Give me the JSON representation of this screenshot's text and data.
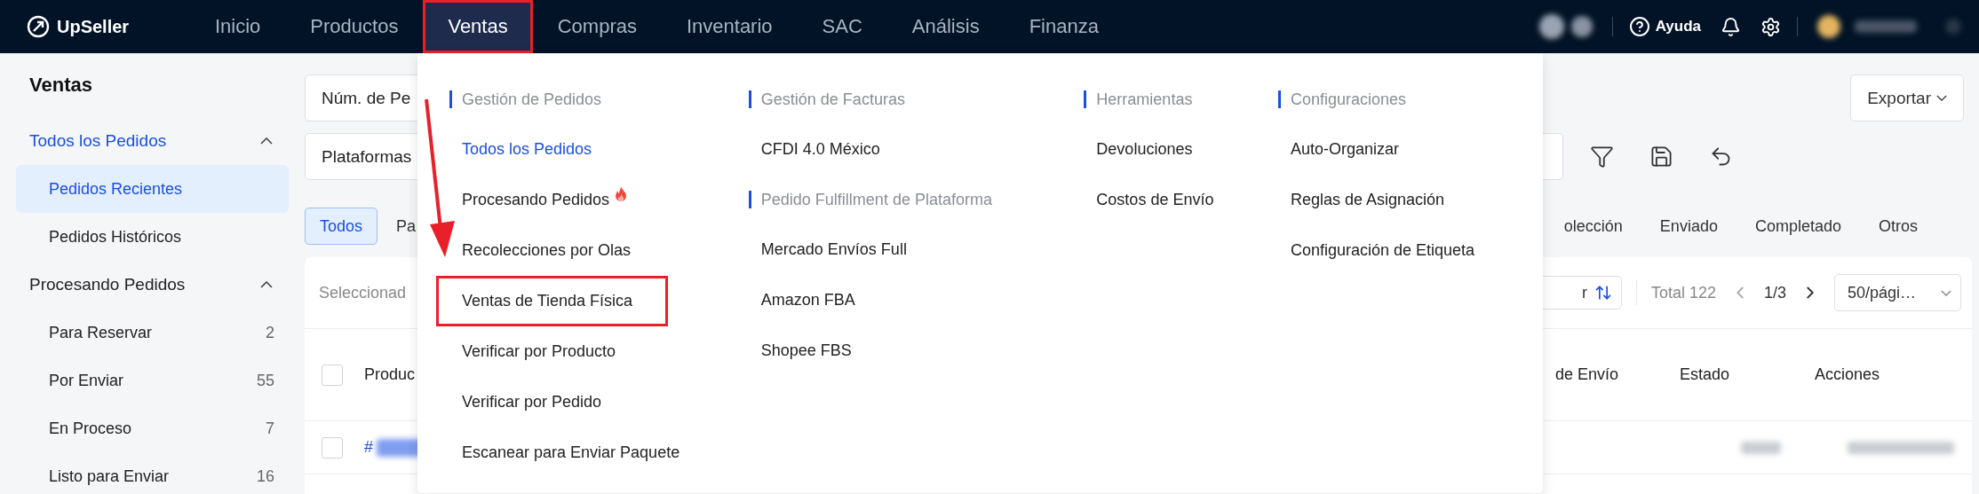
{
  "nav": {
    "logo": "UpSeller",
    "items": [
      {
        "label": "Inicio",
        "selected": false,
        "highlighted": false
      },
      {
        "label": "Productos",
        "selected": false,
        "highlighted": false
      },
      {
        "label": "Ventas",
        "selected": true,
        "highlighted": true
      },
      {
        "label": "Compras",
        "selected": false,
        "highlighted": false
      },
      {
        "label": "Inventario",
        "selected": false,
        "highlighted": false
      },
      {
        "label": "SAC",
        "selected": false,
        "highlighted": false
      },
      {
        "label": "Análisis",
        "selected": false,
        "highlighted": false
      },
      {
        "label": "Finanza",
        "selected": false,
        "highlighted": false
      }
    ],
    "help": "Ayuda"
  },
  "sidebar": {
    "title": "Ventas",
    "groups": [
      {
        "label": "Todos los Pedidos",
        "selected": true,
        "expanded": true,
        "children": [
          {
            "label": "Pedidos Recientes",
            "selected": true
          },
          {
            "label": "Pedidos Históricos",
            "selected": false
          }
        ]
      },
      {
        "label": "Procesando Pedidos",
        "selected": false,
        "expanded": true,
        "children": [
          {
            "label": "Para Reservar",
            "count": "2",
            "selected": false
          },
          {
            "label": "Por Enviar",
            "count": "55",
            "selected": false
          },
          {
            "label": "En Proceso",
            "count": "7",
            "selected": false
          },
          {
            "label": "Listo para Enviar",
            "count": "16",
            "selected": false
          }
        ]
      }
    ]
  },
  "filters": {
    "order_field": "Núm. de Pe",
    "platform_field": "Plataformas",
    "export_button": "Exportar"
  },
  "status_tabs": [
    {
      "label": "Todos",
      "selected": true
    },
    {
      "label": "Pa",
      "selected": false
    },
    {
      "label": "olección",
      "selected": false
    },
    {
      "label": "Enviado",
      "selected": false
    },
    {
      "label": "Completado",
      "selected": false
    },
    {
      "label": "Otros",
      "selected": false
    }
  ],
  "table": {
    "selection_label": "Seleccionad",
    "sort_button": "r",
    "total": "Total 122",
    "page": "1/3",
    "page_size": "50/pági…",
    "columns": [
      "Produc",
      "de Envío",
      "Estado",
      "Acciones"
    ],
    "header_checked": false,
    "rows": [
      {
        "order": "#",
        "checked": false
      }
    ]
  },
  "menu": {
    "columns": [
      {
        "sections": [
          {
            "title": "Gestión de Pedidos",
            "items": [
              {
                "label": "Todos los Pedidos",
                "selected": true,
                "hot": false,
                "highlighted": false
              },
              {
                "label": "Procesando Pedidos",
                "selected": false,
                "hot": true,
                "highlighted": false
              },
              {
                "label": "Recolecciones por Olas",
                "selected": false,
                "hot": false,
                "highlighted": false
              },
              {
                "label": "Ventas de Tienda Física",
                "selected": false,
                "hot": false,
                "highlighted": true
              },
              {
                "label": "Verificar por Producto",
                "selected": false,
                "hot": false,
                "highlighted": false
              },
              {
                "label": "Verificar por Pedido",
                "selected": false,
                "hot": false,
                "highlighted": false
              },
              {
                "label": "Escanear para Enviar Paquete",
                "selected": false,
                "hot": false,
                "highlighted": false
              }
            ]
          }
        ]
      },
      {
        "sections": [
          {
            "title": "Gestión de Facturas",
            "items": [
              {
                "label": "CFDI 4.0 México",
                "selected": false,
                "hot": false,
                "highlighted": false
              }
            ]
          },
          {
            "title": "Pedido Fulfillment de Plataforma",
            "items": [
              {
                "label": "Mercado Envíos Full",
                "selected": false,
                "hot": false,
                "highlighted": false
              },
              {
                "label": "Amazon FBA",
                "selected": false,
                "hot": false,
                "highlighted": false
              },
              {
                "label": "Shopee FBS",
                "selected": false,
                "hot": false,
                "highlighted": false
              }
            ]
          }
        ]
      },
      {
        "sections": [
          {
            "title": "Herramientas",
            "items": [
              {
                "label": "Devoluciones",
                "selected": false,
                "hot": false,
                "highlighted": false
              },
              {
                "label": "Costos de Envío",
                "selected": false,
                "hot": false,
                "highlighted": false
              }
            ]
          }
        ]
      },
      {
        "sections": [
          {
            "title": "Configuraciones",
            "items": [
              {
                "label": "Auto-Organizar",
                "selected": false,
                "hot": false,
                "highlighted": false
              },
              {
                "label": "Reglas de Asignación",
                "selected": false,
                "hot": false,
                "highlighted": false
              },
              {
                "label": "Configuración de Etiqueta",
                "selected": false,
                "hot": false,
                "highlighted": false
              }
            ]
          }
        ]
      }
    ]
  }
}
